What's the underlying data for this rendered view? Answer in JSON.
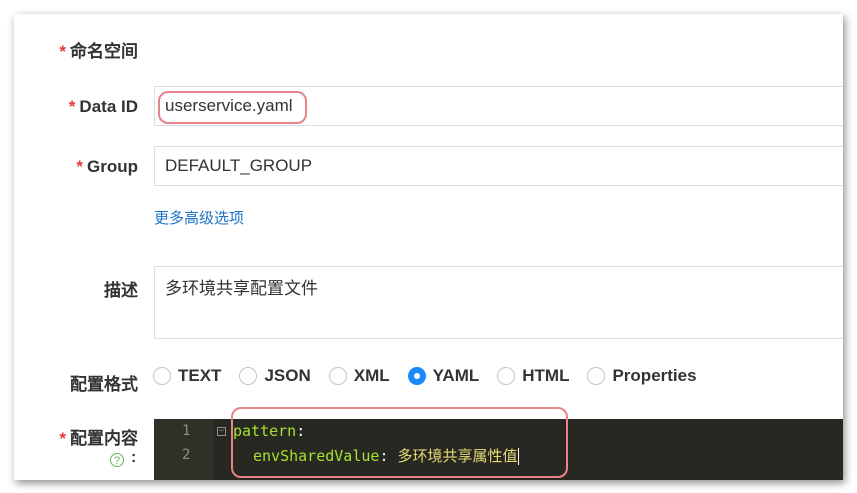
{
  "form": {
    "namespace_label": "命名空间",
    "data_id_label": "Data ID",
    "data_id_value": "userservice.yaml",
    "group_label": "Group",
    "group_value": "DEFAULT_GROUP",
    "advanced_link": "更多高级选项",
    "description_label": "描述",
    "description_value": "多环境共享配置文件",
    "format_label": "配置格式",
    "formats": [
      "TEXT",
      "JSON",
      "XML",
      "YAML",
      "HTML",
      "Properties"
    ],
    "selected_format": "YAML",
    "content_label": "配置内容",
    "content_colon": ":",
    "required_mark": "*"
  },
  "editor": {
    "line_numbers": [
      "1",
      "2"
    ],
    "line1_key": "pattern",
    "line1_colon": ":",
    "line2_key": "envSharedValue",
    "line2_colon": ":",
    "line2_value": "多环境共享属性值"
  },
  "colors": {
    "required": "#e4393c",
    "link": "#1a73c8",
    "radio_checked": "#1989fa",
    "highlight": "#e8838a",
    "editor_bg": "#272822"
  },
  "icons": {
    "help": "question-circle-icon",
    "fold": "fold-minus-icon"
  }
}
